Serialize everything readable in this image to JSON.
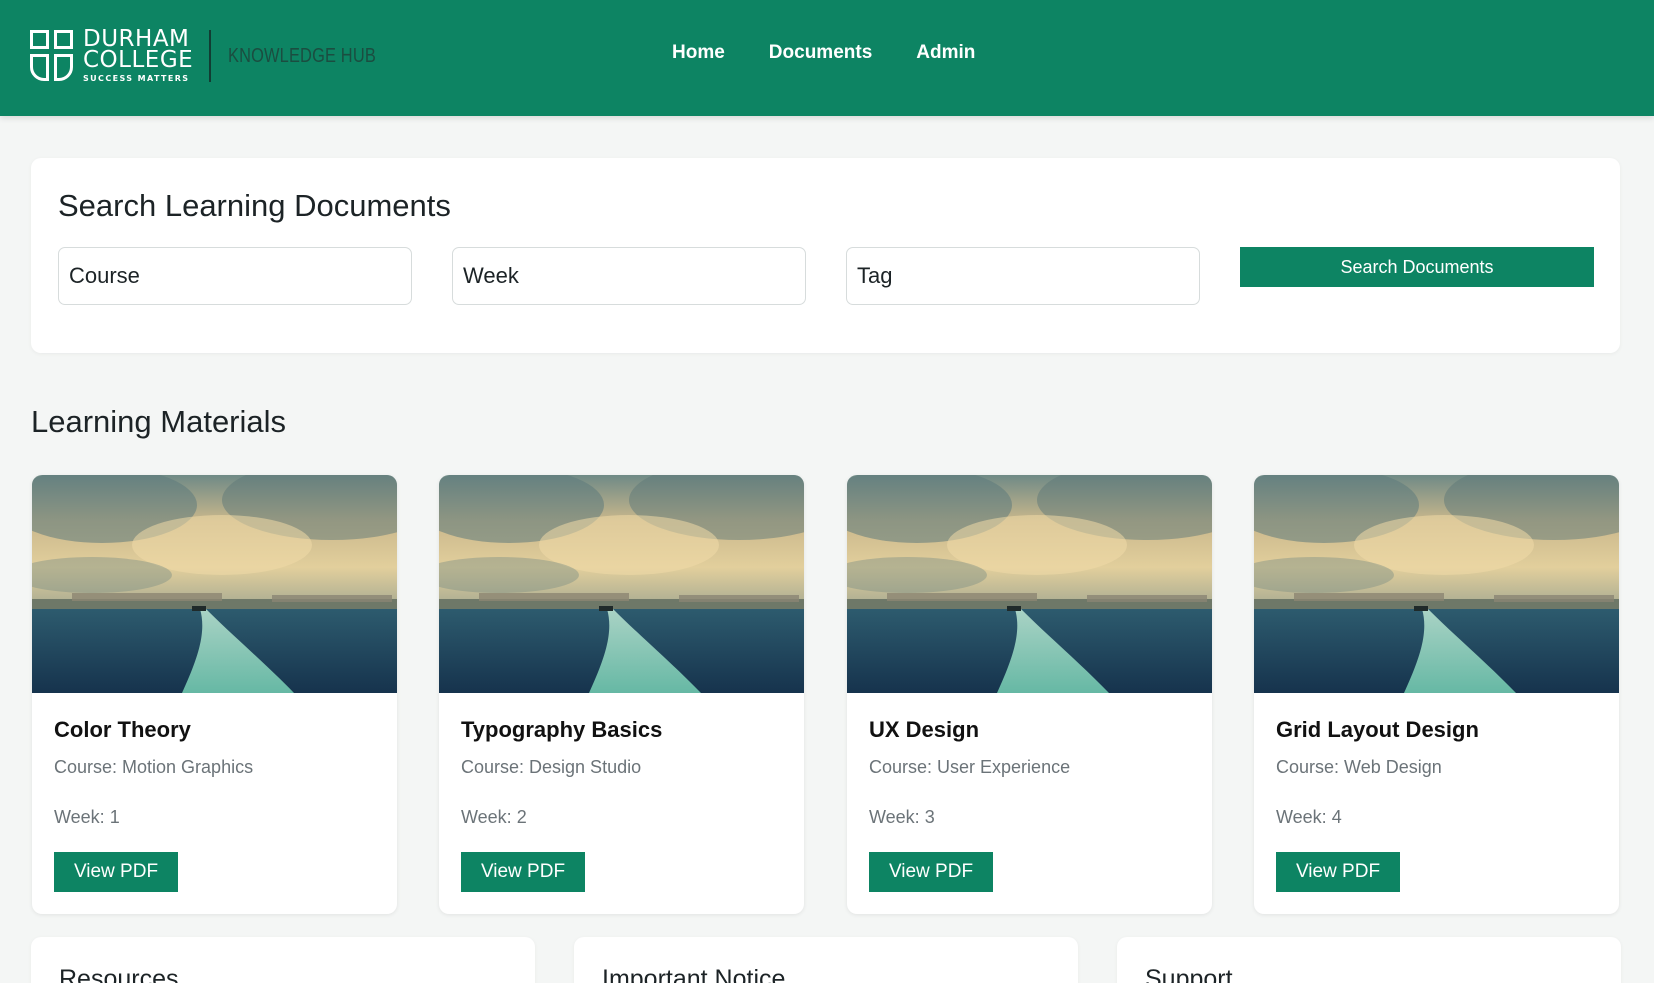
{
  "brand": {
    "line1": "DURHAM",
    "line2": "COLLEGE",
    "tagline": "SUCCESS MATTERS",
    "product": "KNOWLEDGE HUB"
  },
  "nav": {
    "items": [
      {
        "label": "Home"
      },
      {
        "label": "Documents"
      },
      {
        "label": "Admin"
      }
    ]
  },
  "search": {
    "title": "Search Learning Documents",
    "course_placeholder": "Course",
    "week_placeholder": "Week",
    "tag_placeholder": "Tag",
    "button_label": "Search Documents"
  },
  "materials": {
    "title": "Learning Materials",
    "cards": [
      {
        "title": "Color Theory",
        "course": "Course: Motion Graphics",
        "week": "Week: 1",
        "button": "View PDF"
      },
      {
        "title": "Typography Basics",
        "course": "Course: Design Studio",
        "week": "Week: 2",
        "button": "View PDF"
      },
      {
        "title": "UX Design",
        "course": "Course: User Experience",
        "week": "Week: 3",
        "button": "View PDF"
      },
      {
        "title": "Grid Layout Design",
        "course": "Course: Web Design",
        "week": "Week: 4",
        "button": "View PDF"
      }
    ]
  },
  "info_sections": [
    {
      "title": "Resources"
    },
    {
      "title": "Important Notice"
    },
    {
      "title": "Support"
    }
  ],
  "colors": {
    "brand_green": "#0d8463",
    "page_background": "#f4f6f5",
    "card_background": "#ffffff",
    "muted_text": "#6b7378"
  }
}
